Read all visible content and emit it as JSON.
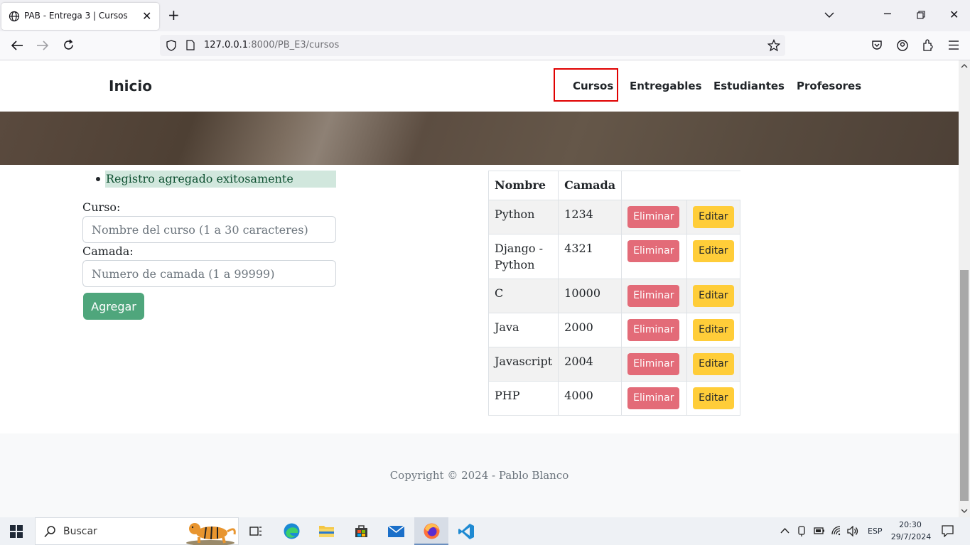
{
  "browser": {
    "tab_title": "PAB - Entrega 3 | Cursos",
    "url_host": "127.0.0.1",
    "url_path": ":8000/PB_E3/cursos"
  },
  "site_nav": {
    "brand": "Inicio",
    "links": [
      "Cursos",
      "Entregables",
      "Estudiantes",
      "Profesores"
    ],
    "active": "Cursos"
  },
  "alert": {
    "message": "Registro agregado exitosamente"
  },
  "form": {
    "curso_label": "Curso:",
    "curso_placeholder": "Nombre del curso (1 a 30 caracteres)",
    "camada_label": "Camada:",
    "camada_placeholder": "Numero de camada (1 a 99999)",
    "submit_label": "Agregar"
  },
  "table": {
    "headers": [
      "Nombre",
      "Camada"
    ],
    "delete_label": "Eliminar",
    "edit_label": "Editar",
    "rows": [
      {
        "nombre": "Python",
        "camada": "1234"
      },
      {
        "nombre": "Django - Python",
        "camada": "4321"
      },
      {
        "nombre": "C",
        "camada": "10000"
      },
      {
        "nombre": "Java",
        "camada": "2000"
      },
      {
        "nombre": "Javascript",
        "camada": "2004"
      },
      {
        "nombre": "PHP",
        "camada": "4000"
      }
    ]
  },
  "footer": {
    "copyright": "Copyright © 2024 - Pablo Blanco"
  },
  "taskbar": {
    "search_label": "Buscar",
    "language": "ESP",
    "time": "20:30",
    "date": "29/7/2024"
  },
  "colors": {
    "nav_highlight": "#e00000",
    "alert_bg": "#d1e7dd",
    "submit_bg": "#4fa67c",
    "delete_bg": "#e36b78",
    "edit_bg": "#ffcd39"
  }
}
